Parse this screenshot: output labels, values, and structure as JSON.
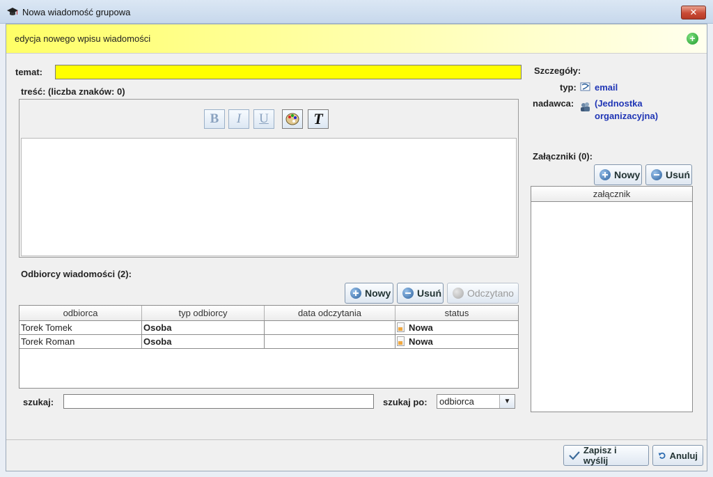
{
  "window": {
    "title": "Nowa wiadomość grupowa",
    "close_label": "✕"
  },
  "header": {
    "title": "edycja nowego wpisu wiadomości"
  },
  "message": {
    "subject_label": "temat:",
    "subject_value": "",
    "content_label": "treść: (liczba znaków: 0)",
    "format_buttons": [
      "B",
      "I",
      "U",
      "",
      "T"
    ]
  },
  "recipients": {
    "title": "Odbiorcy wiadomości (2):",
    "btn_new": "Nowy",
    "btn_remove": "Usuń",
    "btn_read": "Odczytano",
    "columns": [
      "odbiorca",
      "typ odbiorcy",
      "data odczytania",
      "status"
    ],
    "rows": [
      {
        "recipient": "Torek Tomek",
        "type": "Osoba",
        "read_date": "",
        "status": "Nowa"
      },
      {
        "recipient": "Torek Roman",
        "type": "Osoba",
        "read_date": "",
        "status": "Nowa"
      }
    ]
  },
  "search": {
    "label": "szukaj:",
    "value": "",
    "by_label": "szukaj po:",
    "by_value": "odbiorca"
  },
  "details": {
    "title": "Szczegóły:",
    "type_label": "typ:",
    "type_value": "email",
    "sender_label": "nadawca:",
    "sender_line1": "(Jednostka",
    "sender_line2": "organizacyjna)"
  },
  "attachments": {
    "title": "Załączniki (0):",
    "btn_new": "Nowy",
    "btn_remove": "Usuń",
    "column": "załącznik"
  },
  "footer": {
    "save_label": "Zapisz i wyślij",
    "cancel_label": "Anuluj"
  },
  "colors": {
    "subject_bg": "#ffff00",
    "link": "#1f35b5",
    "header_band": "#ffff66"
  }
}
